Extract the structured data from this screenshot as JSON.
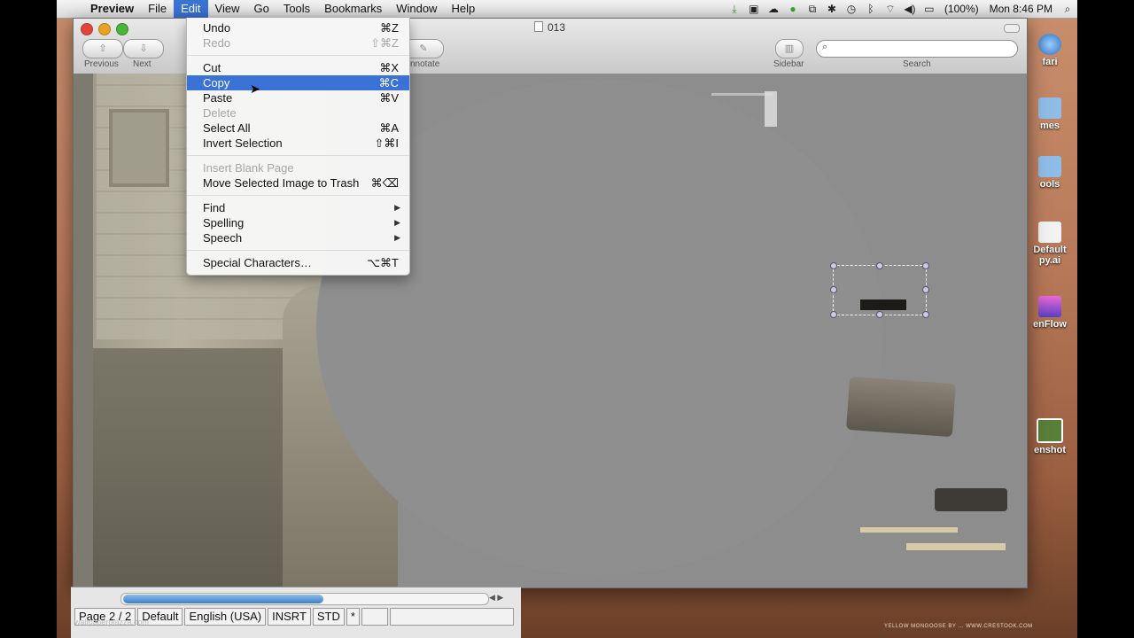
{
  "menubar": {
    "app": "Preview",
    "items": [
      "File",
      "Edit",
      "View",
      "Go",
      "Tools",
      "Bookmarks",
      "Window",
      "Help"
    ],
    "active": "Edit",
    "battery": "(100%)",
    "clock": "Mon 8:46 PM"
  },
  "window": {
    "title": "013",
    "toolbar": {
      "previous": "Previous",
      "next": "Next",
      "annotate": "nnotate",
      "sidebar": "Sidebar",
      "search": "Search"
    }
  },
  "edit_menu": {
    "items": [
      {
        "label": "Undo",
        "shortcut": "⌘Z",
        "enabled": true
      },
      {
        "label": "Redo",
        "shortcut": "⇧⌘Z",
        "enabled": false
      },
      {
        "label": "Cut",
        "shortcut": "⌘X",
        "enabled": true
      },
      {
        "label": "Copy",
        "shortcut": "⌘C",
        "enabled": true,
        "selected": true
      },
      {
        "label": "Paste",
        "shortcut": "⌘V",
        "enabled": true
      },
      {
        "label": "Delete",
        "shortcut": "",
        "enabled": false
      },
      {
        "label": "Select All",
        "shortcut": "⌘A",
        "enabled": true
      },
      {
        "label": "Invert Selection",
        "shortcut": "⇧⌘I",
        "enabled": true
      },
      {
        "label": "Insert Blank Page",
        "shortcut": "",
        "enabled": false
      },
      {
        "label": "Move Selected Image to Trash",
        "shortcut": "⌘⌫",
        "enabled": true
      },
      {
        "label": "Find",
        "submenu": true
      },
      {
        "label": "Spelling",
        "submenu": true
      },
      {
        "label": "Speech",
        "submenu": true
      },
      {
        "label": "Special Characters…",
        "shortcut": "⌥⌘T",
        "enabled": true
      }
    ]
  },
  "desktop_icons": [
    "fari",
    "mes",
    "ools",
    "Default",
    "py.ai",
    "enFlow",
    "enshot"
  ],
  "statusbar": {
    "page": "Page 2 / 2",
    "style": "Default",
    "language": "English (USA)",
    "insert": "INSRT",
    "std": "STD",
    "modified": "*"
  },
  "wallpaper_label": "wallpaperplazza.com",
  "credit": "YELLOW MONGOOSE BY ... WWW.CRESTOOK.COM"
}
